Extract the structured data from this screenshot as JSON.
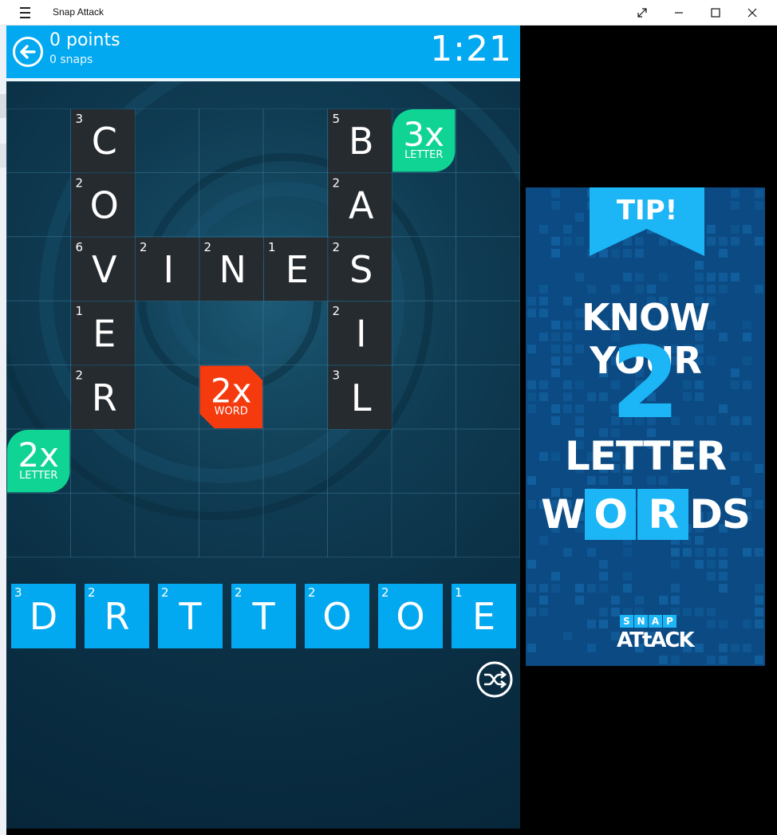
{
  "window": {
    "title": "Snap Attack"
  },
  "header": {
    "points": "0 points",
    "snaps": "0 snaps",
    "timer": "1:21"
  },
  "board_tiles": [
    {
      "col": 1,
      "row": 0,
      "letter": "C",
      "value": "3"
    },
    {
      "col": 5,
      "row": 0,
      "letter": "B",
      "value": "5"
    },
    {
      "col": 1,
      "row": 1,
      "letter": "O",
      "value": "2"
    },
    {
      "col": 5,
      "row": 1,
      "letter": "A",
      "value": "2"
    },
    {
      "col": 1,
      "row": 2,
      "letter": "V",
      "value": "6"
    },
    {
      "col": 2,
      "row": 2,
      "letter": "I",
      "value": "2"
    },
    {
      "col": 3,
      "row": 2,
      "letter": "N",
      "value": "2"
    },
    {
      "col": 4,
      "row": 2,
      "letter": "E",
      "value": "1"
    },
    {
      "col": 5,
      "row": 2,
      "letter": "S",
      "value": "2"
    },
    {
      "col": 1,
      "row": 3,
      "letter": "E",
      "value": "1"
    },
    {
      "col": 5,
      "row": 3,
      "letter": "I",
      "value": "2"
    },
    {
      "col": 1,
      "row": 4,
      "letter": "R",
      "value": "2"
    },
    {
      "col": 5,
      "row": 4,
      "letter": "L",
      "value": "3"
    }
  ],
  "bonus_squares": [
    {
      "col": 6,
      "row": 0,
      "mult": "3x",
      "kind": "LETTER",
      "color": "#0fd494",
      "shape": "leaf"
    },
    {
      "col": 3,
      "row": 4,
      "mult": "2x",
      "kind": "WORD",
      "color": "#f53a0e",
      "shape": "octagon"
    },
    {
      "col": 0,
      "row": 5,
      "mult": "2x",
      "kind": "LETTER",
      "color": "#0fd494",
      "shape": "leaf"
    }
  ],
  "rack": [
    {
      "letter": "D",
      "value": "3"
    },
    {
      "letter": "R",
      "value": "2"
    },
    {
      "letter": "T",
      "value": "2"
    },
    {
      "letter": "T",
      "value": "2"
    },
    {
      "letter": "O",
      "value": "2"
    },
    {
      "letter": "O",
      "value": "2"
    },
    {
      "letter": "E",
      "value": "1"
    }
  ],
  "ad": {
    "tip": "TIP!",
    "line1": "KNOW YOUR",
    "big_number": "2",
    "line3": "LETTER",
    "words": [
      {
        "text": "W",
        "boxed": false
      },
      {
        "text": "O",
        "boxed": true
      },
      {
        "text": "R",
        "boxed": true
      },
      {
        "text": "DS",
        "boxed": false
      }
    ],
    "logo_snap": [
      "S",
      "N",
      "A",
      "P"
    ],
    "logo_attack": "ATtACK"
  },
  "colors": {
    "accent": "#03a9f0",
    "tile": "#262b30",
    "letter_bonus": "#0fd494",
    "word_bonus": "#f53a0e",
    "ad_bg": "#0b4a82",
    "ad_highlight": "#1cb5f6"
  }
}
